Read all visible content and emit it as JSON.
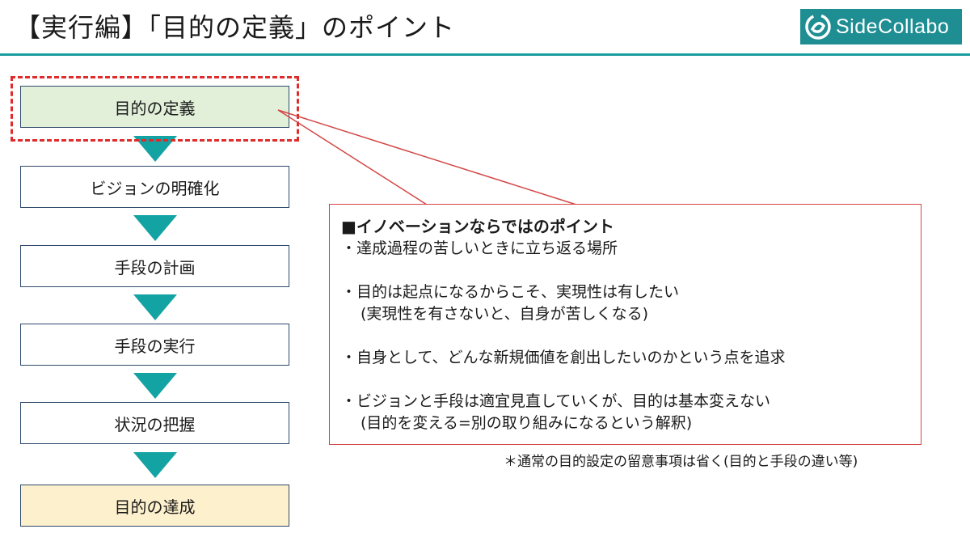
{
  "title": "【実行編】「目的の定義」のポイント",
  "logo": {
    "text": "SideCollabo",
    "icon": "sidecollabo-logo-icon",
    "color": "#1e8e93"
  },
  "colors": {
    "accent": "#1a9c9c",
    "arrow": "#14a3a3",
    "highlight": "#e02b2b",
    "first_step_bg": "#e2efd9",
    "last_step_bg": "#fdf0cc"
  },
  "flow": {
    "steps": [
      "目的の定義",
      "ビジョンの明確化",
      "手段の計画",
      "手段の実行",
      "状況の把握",
      "目的の達成"
    ]
  },
  "callout": {
    "heading": "■イノベーションならではのポイント",
    "points": [
      {
        "line1": "・達成過程の苦しいときに立ち返る場所",
        "line2": ""
      },
      {
        "line1": "・目的は起点になるからこそ、実現性は有したい",
        "line2": "(実現性を有さないと、自身が苦しくなる)"
      },
      {
        "line1": "・自身として、どんな新規価値を創出したいのかという点を追求",
        "line2": ""
      },
      {
        "line1": "・ビジョンと手段は適宜見直していくが、目的は基本変えない",
        "line2": "(目的を変える=別の取り組みになるという解釈)"
      }
    ]
  },
  "footnote": "＊通常の目的設定の留意事項は省く(目的と手段の違い等)"
}
